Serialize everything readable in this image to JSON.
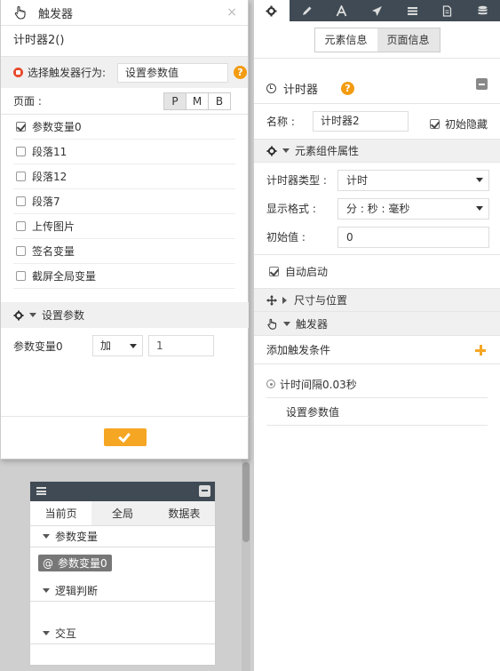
{
  "dialog": {
    "title": "触发器",
    "close": "×",
    "trigger_name": "计时器2()",
    "action_label": "选择触发器行为:",
    "action_value": "设置参数值",
    "help": "?",
    "page_label": "页面 :",
    "page_modes": [
      "P",
      "M",
      "B"
    ],
    "items": [
      {
        "label": "参数变量0",
        "checked": true
      },
      {
        "label": "段落11",
        "checked": false
      },
      {
        "label": "段落12",
        "checked": false
      },
      {
        "label": "段落7",
        "checked": false
      },
      {
        "label": "上传图片",
        "checked": false
      },
      {
        "label": "签名变量",
        "checked": false
      },
      {
        "label": "截屏全局变量",
        "checked": false
      }
    ],
    "param_section": "设置参数",
    "param_row": {
      "name": "参数变量0",
      "operator": "加",
      "value": "1"
    }
  },
  "variables_panel": {
    "tabs": [
      "当前页",
      "全局",
      "数据表"
    ],
    "sections": {
      "params": "参数变量",
      "logic": "逻辑判断",
      "interact": "交互"
    },
    "variable_chip": {
      "at": "@",
      "label": "参数变量0"
    }
  },
  "properties": {
    "toolbar_icons": [
      "gear-icon",
      "pencil-icon",
      "font-icon",
      "send-icon",
      "list-icon",
      "document-icon",
      "database-icon"
    ],
    "tabs": [
      "元素信息",
      "页面信息"
    ],
    "widget_title": "计时器",
    "help": "?",
    "name_label": "名称 :",
    "name_value": "计时器2",
    "init_hidden": "初始隐藏",
    "component_section": "元素组件属性",
    "timer_type_label": "计时器类型 :",
    "timer_type_value": "计时",
    "display_format_label": "显示格式 :",
    "display_format_value": "分 : 秒 : 毫秒",
    "initial_label": "初始值 :",
    "initial_value": "0",
    "autostart": "自动启动",
    "size_section": "尺寸与位置",
    "trigger_section": "触发器",
    "add_condition": "添加触发条件",
    "condition": "计时间隔0.03秒",
    "action": "设置参数值"
  },
  "colors": {
    "accent": "#f5a623",
    "dark_header": "#3f4a54",
    "red_dot": "#e8492c"
  }
}
